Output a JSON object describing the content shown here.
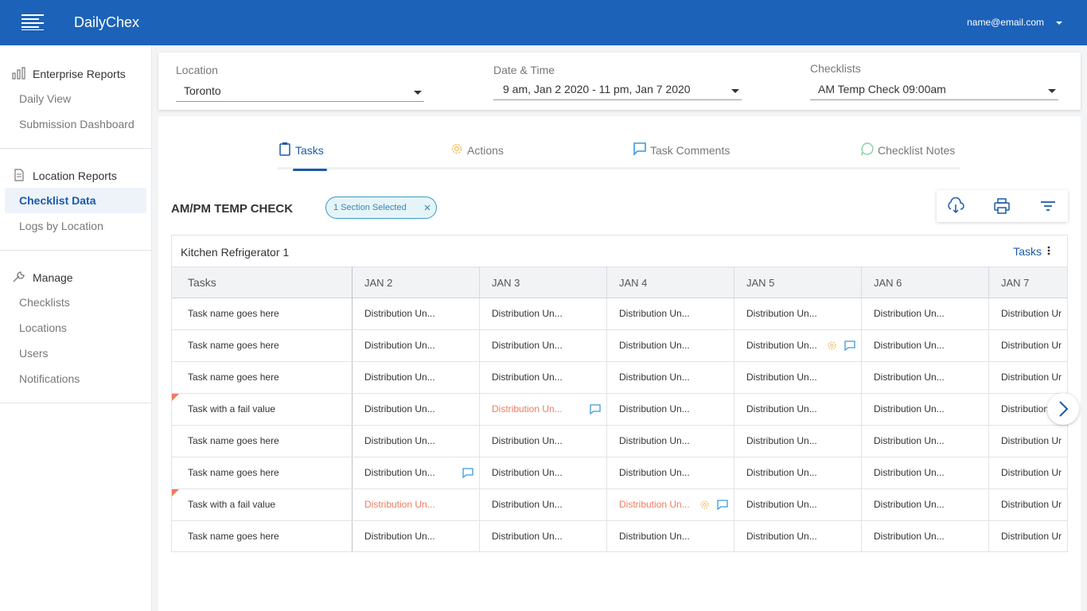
{
  "app": {
    "title": "DailyChex",
    "user_email": "name@email.com"
  },
  "sidebar": {
    "groups": [
      {
        "label": "Enterprise Reports",
        "icon": "bar-chart-icon",
        "items": [
          "Daily View",
          "Submission Dashboard"
        ]
      },
      {
        "label": "Location Reports",
        "icon": "document-icon",
        "items": [
          "Checklist Data",
          "Logs by Location"
        ]
      },
      {
        "label": "Manage",
        "icon": "wrench-icon",
        "items": [
          "Checklists",
          "Locations",
          "Users",
          "Notifications"
        ]
      }
    ],
    "active_item": "Checklist Data"
  },
  "filters": {
    "location": {
      "label": "Location",
      "value": "Toronto"
    },
    "datetime": {
      "label": "Date & Time",
      "value": "9 am, Jan 2 2020 - 11 pm, Jan 7 2020"
    },
    "checklists": {
      "label": "Checklists",
      "value": "AM Temp Check 09:00am"
    }
  },
  "tabs": [
    {
      "label": "Tasks",
      "icon": "clipboard-icon"
    },
    {
      "label": "Actions",
      "icon": "gear-icon"
    },
    {
      "label": "Task Comments",
      "icon": "comment-icon"
    },
    {
      "label": "Checklist Notes",
      "icon": "note-bubble-icon"
    }
  ],
  "active_tab": "Tasks",
  "section": {
    "title": "AM/PM TEMP CHECK",
    "chip": "1 Section Selected"
  },
  "table": {
    "title": "Kitchen Refrigerator 1",
    "menu_label": "Tasks",
    "columns": [
      "Tasks",
      "JAN 2",
      "JAN 3",
      "JAN 4",
      "JAN 5",
      "JAN 6",
      "JAN 7"
    ],
    "cell_text": "Distribution Un...",
    "last_col_text": "Distribution Ur",
    "rows": [
      {
        "task": "Task name goes here"
      },
      {
        "task": "Task name goes here"
      },
      {
        "task": "Task name goes here"
      },
      {
        "task": "Task with a fail value"
      },
      {
        "task": "Task name goes here"
      },
      {
        "task": "Task name goes here"
      },
      {
        "task": "Task with a fail value"
      },
      {
        "task": "Task name goes here"
      }
    ]
  },
  "colors": {
    "brand": "#1c62b9",
    "accent": "#1c5aa6",
    "fail": "#f07b5f",
    "comment": "#3a9bd9",
    "action": "#f5c26b"
  }
}
